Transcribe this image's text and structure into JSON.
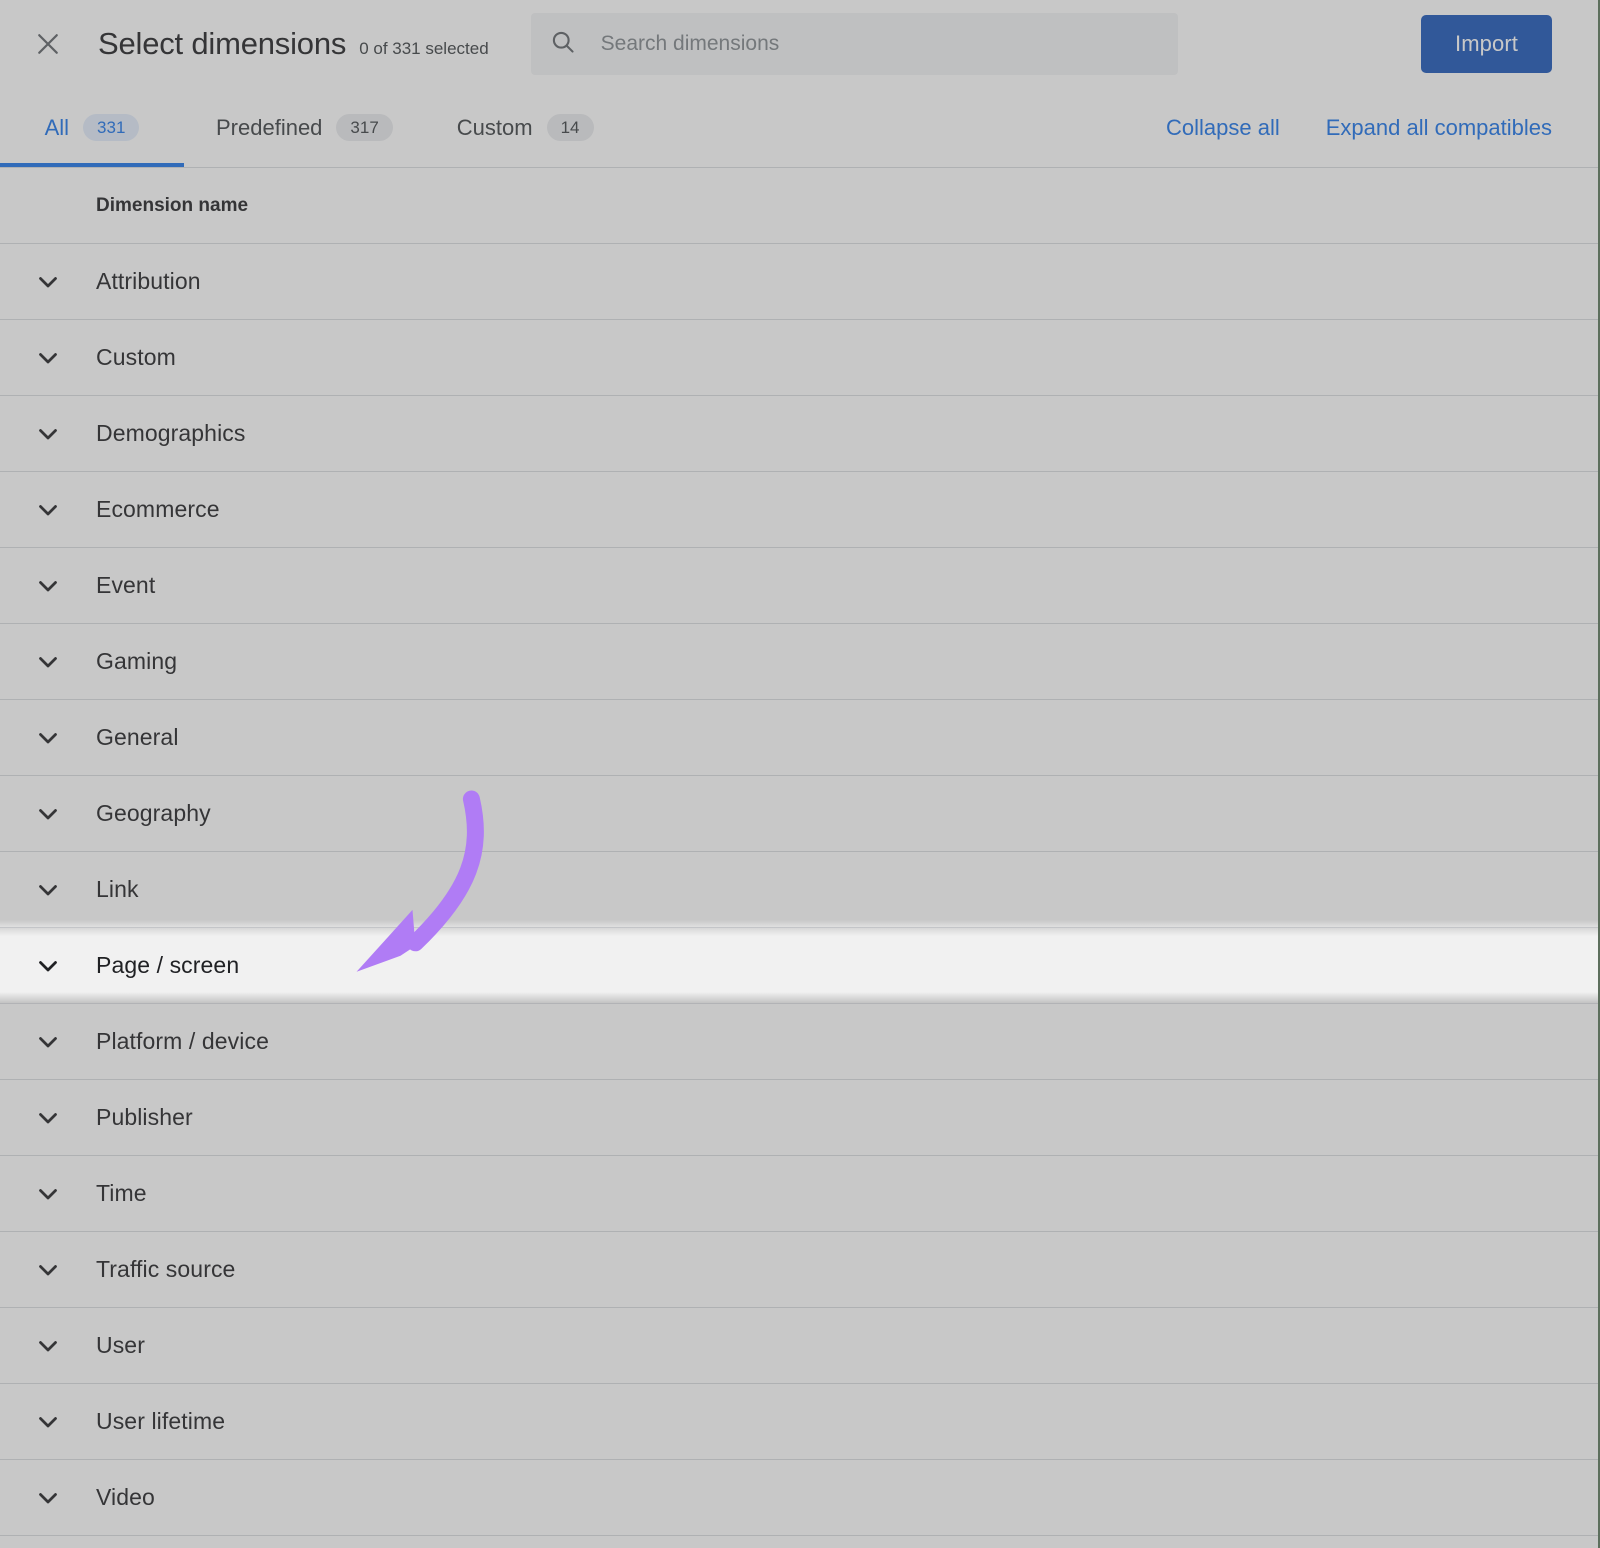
{
  "header": {
    "close_icon": "close-icon",
    "title": "Select dimensions",
    "selection_count": "0 of 331 selected",
    "search": {
      "icon": "search-icon",
      "placeholder": "Search dimensions",
      "value": ""
    },
    "import_label": "Import"
  },
  "tabs": [
    {
      "label": "All",
      "badge": "331",
      "active": true
    },
    {
      "label": "Predefined",
      "badge": "317",
      "active": false
    },
    {
      "label": "Custom",
      "badge": "14",
      "active": false
    }
  ],
  "tab_actions": [
    {
      "label": "Collapse all"
    },
    {
      "label": "Expand all compatibles"
    }
  ],
  "table": {
    "column_header": "Dimension name",
    "rows": [
      {
        "label": "Attribution",
        "icon": "chevron-down-icon",
        "highlighted": false
      },
      {
        "label": "Custom",
        "icon": "chevron-down-icon",
        "highlighted": false
      },
      {
        "label": "Demographics",
        "icon": "chevron-down-icon",
        "highlighted": false
      },
      {
        "label": "Ecommerce",
        "icon": "chevron-down-icon",
        "highlighted": false
      },
      {
        "label": "Event",
        "icon": "chevron-down-icon",
        "highlighted": false
      },
      {
        "label": "Gaming",
        "icon": "chevron-down-icon",
        "highlighted": false
      },
      {
        "label": "General",
        "icon": "chevron-down-icon",
        "highlighted": false
      },
      {
        "label": "Geography",
        "icon": "chevron-down-icon",
        "highlighted": false
      },
      {
        "label": "Link",
        "icon": "chevron-down-icon",
        "highlighted": false
      },
      {
        "label": "Page / screen",
        "icon": "chevron-down-icon",
        "highlighted": true
      },
      {
        "label": "Platform / device",
        "icon": "chevron-down-icon",
        "highlighted": false
      },
      {
        "label": "Publisher",
        "icon": "chevron-down-icon",
        "highlighted": false
      },
      {
        "label": "Time",
        "icon": "chevron-down-icon",
        "highlighted": false
      },
      {
        "label": "Traffic source",
        "icon": "chevron-down-icon",
        "highlighted": false
      },
      {
        "label": "User",
        "icon": "chevron-down-icon",
        "highlighted": false
      },
      {
        "label": "User lifetime",
        "icon": "chevron-down-icon",
        "highlighted": false
      },
      {
        "label": "Video",
        "icon": "chevron-down-icon",
        "highlighted": false
      }
    ]
  },
  "annotation": {
    "icon": "curved-arrow-icon",
    "color": "#b07cf5",
    "points_to": "Page / screen"
  },
  "colors": {
    "accent_blue": "#1a73e8",
    "import_button": "#1a56b8",
    "annotation_purple": "#b07cf5",
    "row_highlight": "#f1f1f1",
    "dim_overlay": "rgba(94,94,94,0.34)"
  }
}
